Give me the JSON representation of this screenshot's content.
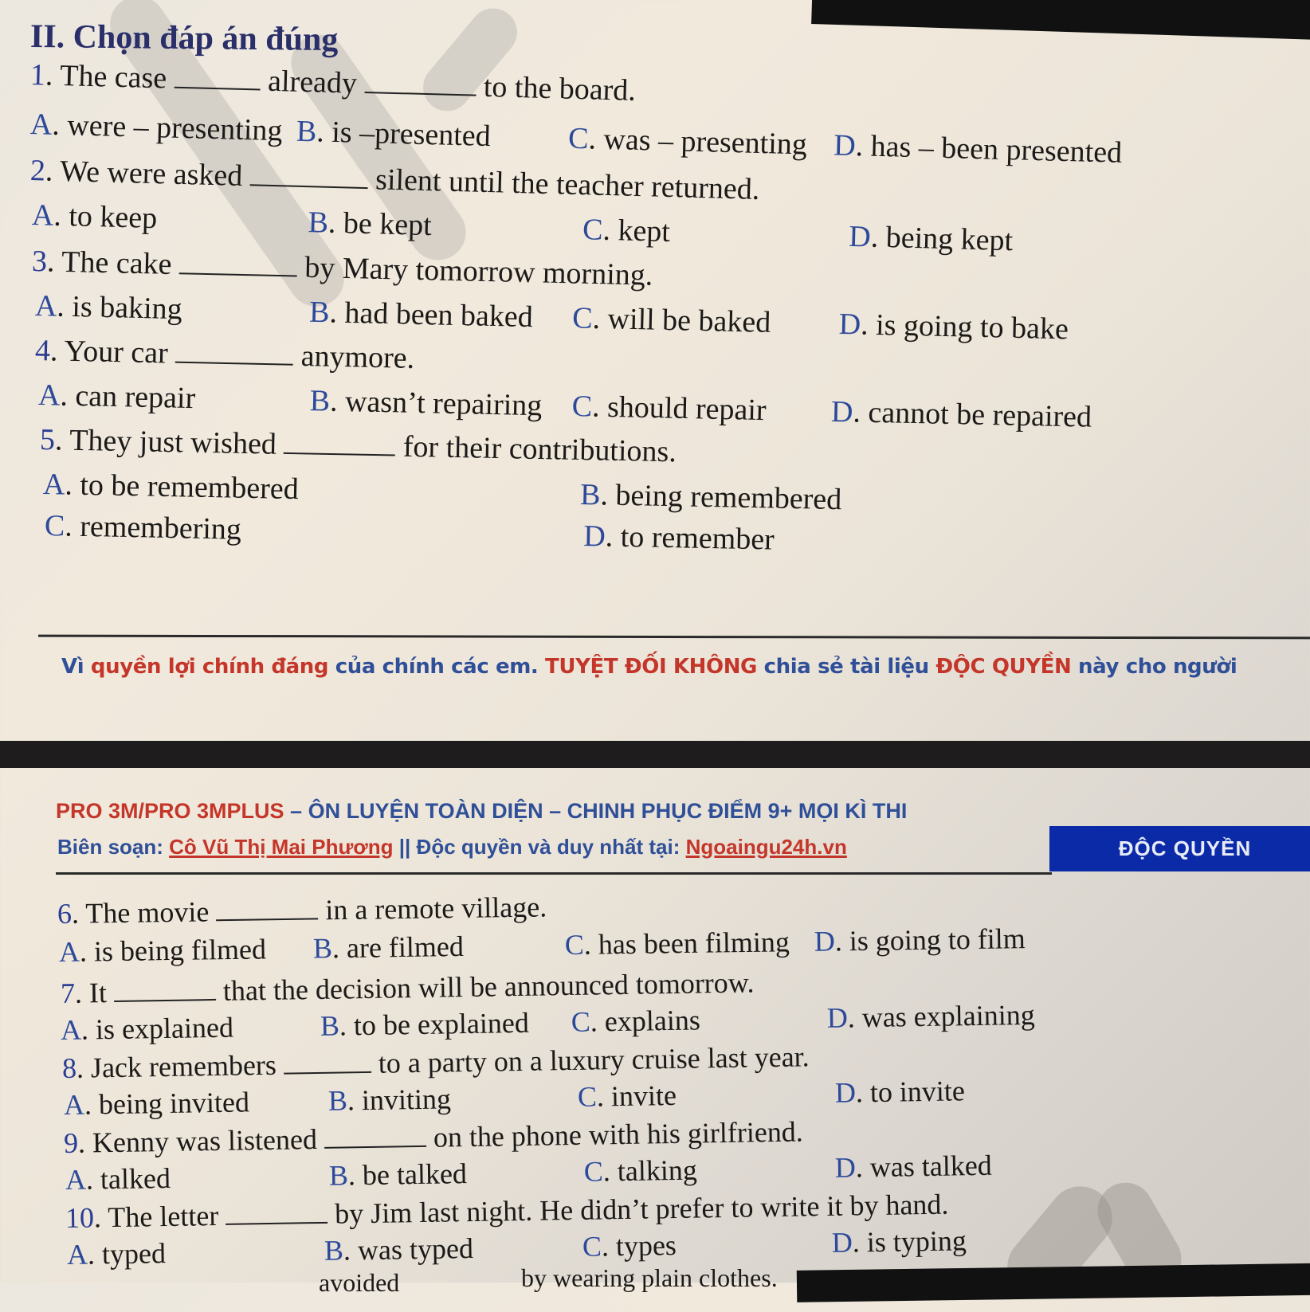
{
  "section_title": "II. Chọn đáp án đúng",
  "questions": [
    {
      "num": "1",
      "parts": [
        "The case",
        "already",
        "to the board."
      ],
      "options": [
        {
          "letter": "A",
          "text": "were – presenting"
        },
        {
          "letter": "B",
          "text": "is –presented"
        },
        {
          "letter": "C",
          "text": "was – presenting"
        },
        {
          "letter": "D",
          "text": "has – been presented"
        }
      ]
    },
    {
      "num": "2",
      "parts": [
        "We were asked",
        "silent until the teacher returned."
      ],
      "options": [
        {
          "letter": "A",
          "text": "to keep"
        },
        {
          "letter": "B",
          "text": "be kept"
        },
        {
          "letter": "C",
          "text": "kept"
        },
        {
          "letter": "D",
          "text": "being kept"
        }
      ]
    },
    {
      "num": "3",
      "parts": [
        "The cake",
        "by Mary tomorrow morning."
      ],
      "options": [
        {
          "letter": "A",
          "text": "is baking"
        },
        {
          "letter": "B",
          "text": "had been baked"
        },
        {
          "letter": "C",
          "text": "will be baked"
        },
        {
          "letter": "D",
          "text": "is going to bake"
        }
      ]
    },
    {
      "num": "4",
      "parts": [
        "Your car",
        "anymore."
      ],
      "options": [
        {
          "letter": "A",
          "text": "can repair"
        },
        {
          "letter": "B",
          "text": "wasn’t repairing"
        },
        {
          "letter": "C",
          "text": "should repair"
        },
        {
          "letter": "D",
          "text": "cannot be repaired"
        }
      ]
    },
    {
      "num": "5",
      "parts": [
        "They just wished",
        "for their contributions."
      ],
      "options": [
        {
          "letter": "A",
          "text": "to be remembered"
        },
        {
          "letter": "B",
          "text": "being remembered"
        },
        {
          "letter": "C",
          "text": "remembering"
        },
        {
          "letter": "D",
          "text": "to remember"
        }
      ]
    },
    {
      "num": "6",
      "parts": [
        "The movie",
        "in a remote village."
      ],
      "options": [
        {
          "letter": "A",
          "text": "is being filmed"
        },
        {
          "letter": "B",
          "text": "are filmed"
        },
        {
          "letter": "C",
          "text": "has been filming"
        },
        {
          "letter": "D",
          "text": "is going to film"
        }
      ]
    },
    {
      "num": "7",
      "parts": [
        "It",
        "that the decision will be announced tomorrow."
      ],
      "options": [
        {
          "letter": "A",
          "text": "is explained"
        },
        {
          "letter": "B",
          "text": "to be explained"
        },
        {
          "letter": "C",
          "text": "explains"
        },
        {
          "letter": "D",
          "text": "was explaining"
        }
      ]
    },
    {
      "num": "8",
      "parts": [
        "Jack remembers",
        "to a party on a luxury cruise last year."
      ],
      "options": [
        {
          "letter": "A",
          "text": "being invited"
        },
        {
          "letter": "B",
          "text": "inviting"
        },
        {
          "letter": "C",
          "text": "invite"
        },
        {
          "letter": "D",
          "text": "to invite"
        }
      ]
    },
    {
      "num": "9",
      "parts": [
        "Kenny was listened",
        "on the phone with his girlfriend."
      ],
      "options": [
        {
          "letter": "A",
          "text": "talked"
        },
        {
          "letter": "B",
          "text": "be talked"
        },
        {
          "letter": "C",
          "text": "talking"
        },
        {
          "letter": "D",
          "text": "was talked"
        }
      ]
    },
    {
      "num": "10",
      "parts": [
        "The letter",
        "by Jim last night. He didn’t prefer to write it by hand."
      ],
      "options": [
        {
          "letter": "A",
          "text": "typed"
        },
        {
          "letter": "B",
          "text": "was typed"
        },
        {
          "letter": "C",
          "text": "types"
        },
        {
          "letter": "D",
          "text": "is typing"
        }
      ]
    }
  ],
  "cutoff_line": {
    "left": "avoided",
    "right": "by wearing plain clothes."
  },
  "notice": {
    "segments": [
      {
        "text": "Vì ",
        "color": "blue"
      },
      {
        "text": "quyền lợi chính đáng ",
        "color": "red"
      },
      {
        "text": "của chính các em. ",
        "color": "blue"
      },
      {
        "text": "TUYỆT ĐỐI KHÔNG ",
        "color": "red"
      },
      {
        "text": "chia sẻ tài liệu ",
        "color": "blue"
      },
      {
        "text": "ĐỘC QUYỀN ",
        "color": "red"
      },
      {
        "text": "này cho người",
        "color": "blue"
      }
    ]
  },
  "header": {
    "course_red": "PRO 3M/PRO 3MPLUS",
    "course_blue": " – ÔN LUYỆN TOÀN DIỆN – CHINH PHỤC ĐIỂM 9+ MỌI KÌ THI",
    "author_label": "Biên soạn: ",
    "author_name": "Cô Vũ Thị Mai Phương",
    "exclusive_text": " || Độc quyền và duy nhất tại: ",
    "site": "Ngoaingu24h.vn",
    "badge": "ĐỘC QUYỀN"
  },
  "colors": {
    "red": "#c5362a",
    "blue": "#2f4f98",
    "badge_bg": "#0b2aa8",
    "letter_blue": "#2b3d93"
  }
}
